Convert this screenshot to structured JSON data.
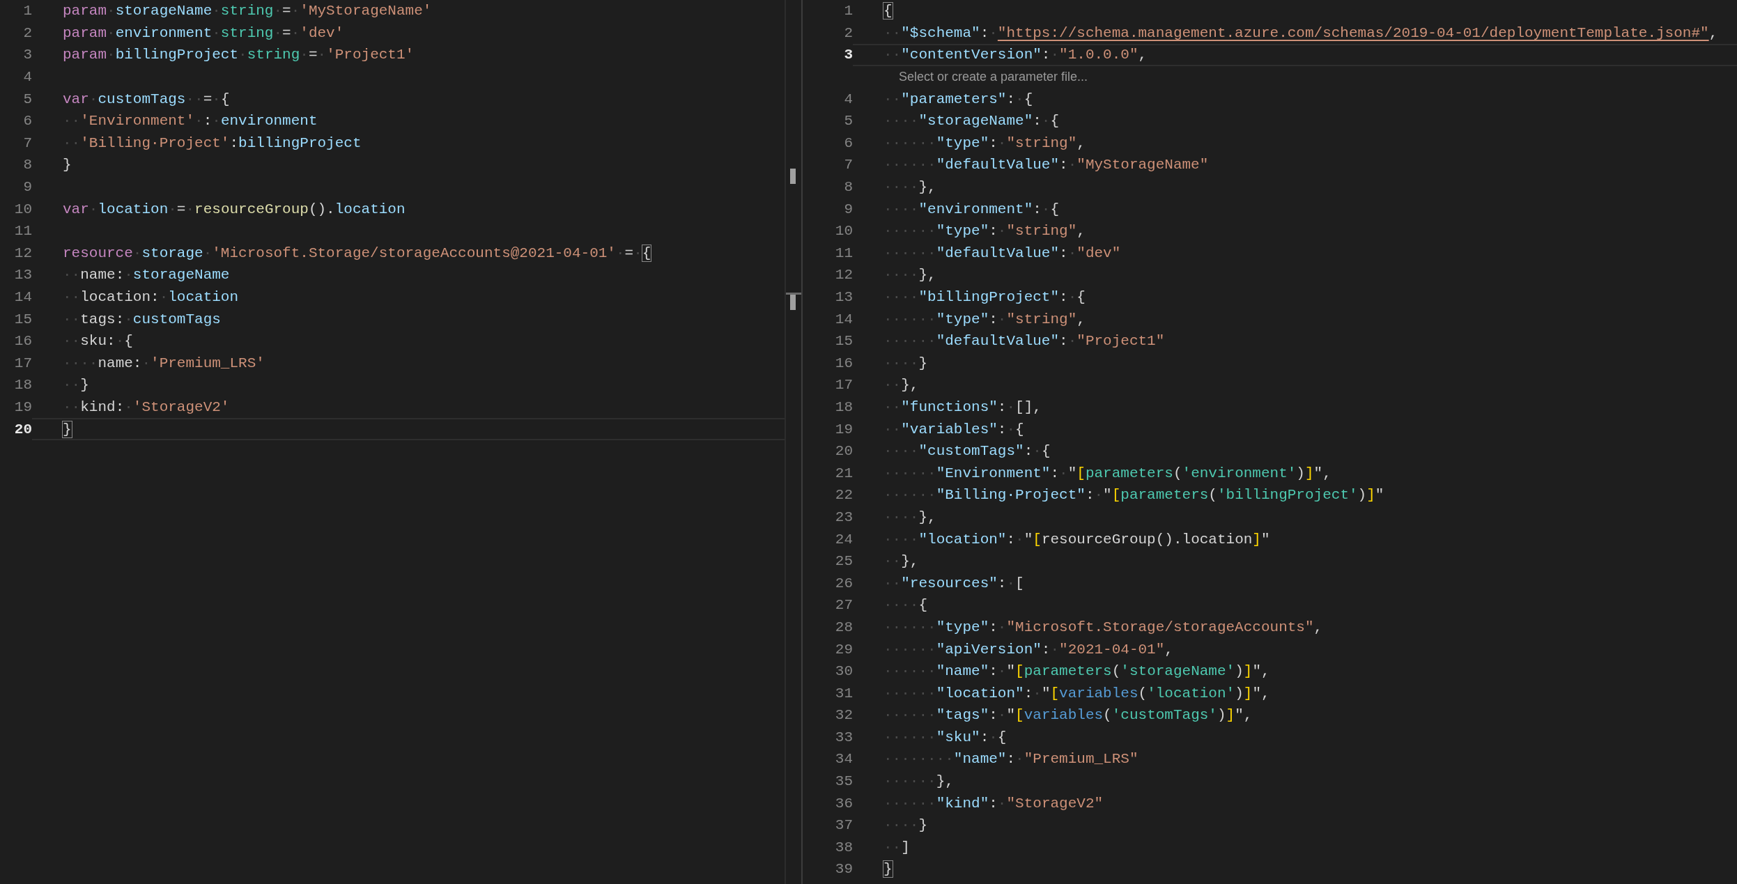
{
  "left_editor": {
    "lines": [
      {
        "number": "1",
        "current": false,
        "tokens": [
          {
            "kind": "kw",
            "text": "param"
          },
          {
            "kind": "ws",
            "text": "·"
          },
          {
            "kind": "id",
            "text": "storageName"
          },
          {
            "kind": "ws",
            "text": "·"
          },
          {
            "kind": "type",
            "text": "string"
          },
          {
            "kind": "ws",
            "text": "·"
          },
          {
            "kind": "p",
            "text": "="
          },
          {
            "kind": "ws",
            "text": "·"
          },
          {
            "kind": "str",
            "text": "'MyStorageName'"
          }
        ]
      },
      {
        "number": "2",
        "current": false,
        "tokens": [
          {
            "kind": "kw",
            "text": "param"
          },
          {
            "kind": "ws",
            "text": "·"
          },
          {
            "kind": "id",
            "text": "environment"
          },
          {
            "kind": "ws",
            "text": "·"
          },
          {
            "kind": "type",
            "text": "string"
          },
          {
            "kind": "ws",
            "text": "·"
          },
          {
            "kind": "p",
            "text": "="
          },
          {
            "kind": "ws",
            "text": "·"
          },
          {
            "kind": "str",
            "text": "'dev'"
          }
        ]
      },
      {
        "number": "3",
        "current": false,
        "tokens": [
          {
            "kind": "kw",
            "text": "param"
          },
          {
            "kind": "ws",
            "text": "·"
          },
          {
            "kind": "id",
            "text": "billingProject"
          },
          {
            "kind": "ws",
            "text": "·"
          },
          {
            "kind": "type",
            "text": "string"
          },
          {
            "kind": "ws",
            "text": "·"
          },
          {
            "kind": "p",
            "text": "="
          },
          {
            "kind": "ws",
            "text": "·"
          },
          {
            "kind": "str",
            "text": "'Project1'"
          }
        ]
      },
      {
        "number": "4",
        "current": false
      },
      {
        "number": "5",
        "current": false,
        "tokens": [
          {
            "kind": "kw",
            "text": "var"
          },
          {
            "kind": "ws",
            "text": "·"
          },
          {
            "kind": "id",
            "text": "customTags"
          },
          {
            "kind": "ws",
            "text": "··"
          },
          {
            "kind": "p",
            "text": "="
          },
          {
            "kind": "ws",
            "text": "·"
          },
          {
            "kind": "p",
            "text": "{"
          }
        ]
      },
      {
        "number": "6",
        "current": false,
        "tokens": [
          {
            "kind": "ws",
            "text": "··"
          },
          {
            "kind": "str",
            "text": "'Environment'"
          },
          {
            "kind": "ws",
            "text": "·"
          },
          {
            "kind": "p",
            "text": ":"
          },
          {
            "kind": "ws",
            "text": "·"
          },
          {
            "kind": "id",
            "text": "environment"
          }
        ]
      },
      {
        "number": "7",
        "current": false,
        "tokens": [
          {
            "kind": "ws",
            "text": "··"
          },
          {
            "kind": "str",
            "text": "'Billing·Project'"
          },
          {
            "kind": "p",
            "text": ":"
          },
          {
            "kind": "id",
            "text": "billingProject"
          }
        ]
      },
      {
        "number": "8",
        "current": false,
        "tokens": [
          {
            "kind": "p",
            "text": "}"
          }
        ]
      },
      {
        "number": "9",
        "current": false
      },
      {
        "number": "10",
        "current": false,
        "tokens": [
          {
            "kind": "kw",
            "text": "var"
          },
          {
            "kind": "ws",
            "text": "·"
          },
          {
            "kind": "id",
            "text": "location"
          },
          {
            "kind": "ws",
            "text": "·"
          },
          {
            "kind": "p",
            "text": "="
          },
          {
            "kind": "ws",
            "text": "·"
          },
          {
            "kind": "fn",
            "text": "resourceGroup"
          },
          {
            "kind": "p",
            "text": "()."
          },
          {
            "kind": "id",
            "text": "location"
          }
        ]
      },
      {
        "number": "11",
        "current": false
      },
      {
        "number": "12",
        "current": false,
        "tokens": [
          {
            "kind": "kw",
            "text": "resource"
          },
          {
            "kind": "ws",
            "text": "·"
          },
          {
            "kind": "id",
            "text": "storage"
          },
          {
            "kind": "ws",
            "text": "·"
          },
          {
            "kind": "str",
            "text": "'Microsoft.Storage/storageAccounts@2021-04-01'"
          },
          {
            "kind": "ws",
            "text": "·"
          },
          {
            "kind": "p",
            "text": "="
          },
          {
            "kind": "ws",
            "text": "·"
          },
          {
            "kind": "m",
            "text": "{"
          }
        ]
      },
      {
        "number": "13",
        "current": false,
        "tokens": [
          {
            "kind": "ws",
            "text": "··"
          },
          {
            "kind": "p",
            "text": "name:"
          },
          {
            "kind": "ws",
            "text": "·"
          },
          {
            "kind": "id",
            "text": "storageName"
          }
        ]
      },
      {
        "number": "14",
        "current": false,
        "tokens": [
          {
            "kind": "ws",
            "text": "··"
          },
          {
            "kind": "p",
            "text": "location:"
          },
          {
            "kind": "ws",
            "text": "·"
          },
          {
            "kind": "id",
            "text": "location"
          }
        ]
      },
      {
        "number": "15",
        "current": false,
        "tokens": [
          {
            "kind": "ws",
            "text": "··"
          },
          {
            "kind": "p",
            "text": "tags:"
          },
          {
            "kind": "ws",
            "text": "·"
          },
          {
            "kind": "id",
            "text": "customTags"
          }
        ]
      },
      {
        "number": "16",
        "current": false,
        "tokens": [
          {
            "kind": "ws",
            "text": "··"
          },
          {
            "kind": "p",
            "text": "sku:"
          },
          {
            "kind": "ws",
            "text": "·"
          },
          {
            "kind": "p",
            "text": "{"
          }
        ]
      },
      {
        "number": "17",
        "current": false,
        "tokens": [
          {
            "kind": "ws",
            "text": "····"
          },
          {
            "kind": "p",
            "text": "name:"
          },
          {
            "kind": "ws",
            "text": "·"
          },
          {
            "kind": "str",
            "text": "'Premium_LRS'"
          }
        ]
      },
      {
        "number": "18",
        "current": false,
        "tokens": [
          {
            "kind": "ws",
            "text": "··"
          },
          {
            "kind": "p",
            "text": "}"
          }
        ]
      },
      {
        "number": "19",
        "current": false,
        "tokens": [
          {
            "kind": "ws",
            "text": "··"
          },
          {
            "kind": "p",
            "text": "kind:"
          },
          {
            "kind": "ws",
            "text": "·"
          },
          {
            "kind": "str",
            "text": "'StorageV2'"
          }
        ]
      },
      {
        "number": "20",
        "current": true,
        "tokens": [
          {
            "kind": "m",
            "text": "}"
          }
        ]
      }
    ]
  },
  "right_editor": {
    "lines": [
      {
        "number": "1",
        "current": false,
        "tokens": [
          {
            "kind": "m",
            "text": "{"
          }
        ]
      },
      {
        "number": "2",
        "current": false,
        "tokens": [
          {
            "kind": "ws",
            "text": "··"
          },
          {
            "kind": "key",
            "text": "\"$schema\""
          },
          {
            "kind": "p",
            "text": ":"
          },
          {
            "kind": "ws",
            "text": "·"
          },
          {
            "kind": "link",
            "text": "\"https://schema.management.azure.com/schemas/2019-04-01/deploymentTemplate.json#\""
          },
          {
            "kind": "p",
            "text": ","
          }
        ]
      },
      {
        "number": "3",
        "current": true,
        "codelens": "Select or create a parameter file...",
        "tokens": [
          {
            "kind": "ws",
            "text": "··"
          },
          {
            "kind": "key",
            "text": "\"contentVersion\""
          },
          {
            "kind": "p",
            "text": ":"
          },
          {
            "kind": "ws",
            "text": "·"
          },
          {
            "kind": "str",
            "text": "\"1.0.0.0\""
          },
          {
            "kind": "p",
            "text": ","
          }
        ]
      },
      {
        "number": "4",
        "current": false,
        "tokens": [
          {
            "kind": "ws",
            "text": "··"
          },
          {
            "kind": "key",
            "text": "\"parameters\""
          },
          {
            "kind": "p",
            "text": ":"
          },
          {
            "kind": "ws",
            "text": "·"
          },
          {
            "kind": "p",
            "text": "{"
          }
        ]
      },
      {
        "number": "5",
        "current": false,
        "tokens": [
          {
            "kind": "ws",
            "text": "····"
          },
          {
            "kind": "key",
            "text": "\"storageName\""
          },
          {
            "kind": "p",
            "text": ":"
          },
          {
            "kind": "ws",
            "text": "·"
          },
          {
            "kind": "p",
            "text": "{"
          }
        ]
      },
      {
        "number": "6",
        "current": false,
        "tokens": [
          {
            "kind": "ws",
            "text": "······"
          },
          {
            "kind": "key",
            "text": "\"type\""
          },
          {
            "kind": "p",
            "text": ":"
          },
          {
            "kind": "ws",
            "text": "·"
          },
          {
            "kind": "str",
            "text": "\"string\""
          },
          {
            "kind": "p",
            "text": ","
          }
        ]
      },
      {
        "number": "7",
        "current": false,
        "tokens": [
          {
            "kind": "ws",
            "text": "······"
          },
          {
            "kind": "key",
            "text": "\"defaultValue\""
          },
          {
            "kind": "p",
            "text": ":"
          },
          {
            "kind": "ws",
            "text": "·"
          },
          {
            "kind": "str",
            "text": "\"MyStorageName\""
          }
        ]
      },
      {
        "number": "8",
        "current": false,
        "tokens": [
          {
            "kind": "ws",
            "text": "····"
          },
          {
            "kind": "p",
            "text": "},"
          }
        ]
      },
      {
        "number": "9",
        "current": false,
        "tokens": [
          {
            "kind": "ws",
            "text": "····"
          },
          {
            "kind": "key",
            "text": "\"environment\""
          },
          {
            "kind": "p",
            "text": ":"
          },
          {
            "kind": "ws",
            "text": "·"
          },
          {
            "kind": "p",
            "text": "{"
          }
        ]
      },
      {
        "number": "10",
        "current": false,
        "tokens": [
          {
            "kind": "ws",
            "text": "······"
          },
          {
            "kind": "key",
            "text": "\"type\""
          },
          {
            "kind": "p",
            "text": ":"
          },
          {
            "kind": "ws",
            "text": "·"
          },
          {
            "kind": "str",
            "text": "\"string\""
          },
          {
            "kind": "p",
            "text": ","
          }
        ]
      },
      {
        "number": "11",
        "current": false,
        "tokens": [
          {
            "kind": "ws",
            "text": "······"
          },
          {
            "kind": "key",
            "text": "\"defaultValue\""
          },
          {
            "kind": "p",
            "text": ":"
          },
          {
            "kind": "ws",
            "text": "·"
          },
          {
            "kind": "str",
            "text": "\"dev\""
          }
        ]
      },
      {
        "number": "12",
        "current": false,
        "tokens": [
          {
            "kind": "ws",
            "text": "····"
          },
          {
            "kind": "p",
            "text": "},"
          }
        ]
      },
      {
        "number": "13",
        "current": false,
        "tokens": [
          {
            "kind": "ws",
            "text": "····"
          },
          {
            "kind": "key",
            "text": "\"billingProject\""
          },
          {
            "kind": "p",
            "text": ":"
          },
          {
            "kind": "ws",
            "text": "·"
          },
          {
            "kind": "p",
            "text": "{"
          }
        ]
      },
      {
        "number": "14",
        "current": false,
        "tokens": [
          {
            "kind": "ws",
            "text": "······"
          },
          {
            "kind": "key",
            "text": "\"type\""
          },
          {
            "kind": "p",
            "text": ":"
          },
          {
            "kind": "ws",
            "text": "·"
          },
          {
            "kind": "str",
            "text": "\"string\""
          },
          {
            "kind": "p",
            "text": ","
          }
        ]
      },
      {
        "number": "15",
        "current": false,
        "tokens": [
          {
            "kind": "ws",
            "text": "······"
          },
          {
            "kind": "key",
            "text": "\"defaultValue\""
          },
          {
            "kind": "p",
            "text": ":"
          },
          {
            "kind": "ws",
            "text": "·"
          },
          {
            "kind": "str",
            "text": "\"Project1\""
          }
        ]
      },
      {
        "number": "16",
        "current": false,
        "tokens": [
          {
            "kind": "ws",
            "text": "····"
          },
          {
            "kind": "p",
            "text": "}"
          }
        ]
      },
      {
        "number": "17",
        "current": false,
        "tokens": [
          {
            "kind": "ws",
            "text": "··"
          },
          {
            "kind": "p",
            "text": "},"
          }
        ]
      },
      {
        "number": "18",
        "current": false,
        "tokens": [
          {
            "kind": "ws",
            "text": "··"
          },
          {
            "kind": "key",
            "text": "\"functions\""
          },
          {
            "kind": "p",
            "text": ":"
          },
          {
            "kind": "ws",
            "text": "·"
          },
          {
            "kind": "p",
            "text": "[],"
          }
        ]
      },
      {
        "number": "19",
        "current": false,
        "tokens": [
          {
            "kind": "ws",
            "text": "··"
          },
          {
            "kind": "key",
            "text": "\"variables\""
          },
          {
            "kind": "p",
            "text": ":"
          },
          {
            "kind": "ws",
            "text": "·"
          },
          {
            "kind": "p",
            "text": "{"
          }
        ]
      },
      {
        "number": "20",
        "current": false,
        "tokens": [
          {
            "kind": "ws",
            "text": "····"
          },
          {
            "kind": "key",
            "text": "\"customTags\""
          },
          {
            "kind": "p",
            "text": ":"
          },
          {
            "kind": "ws",
            "text": "·"
          },
          {
            "kind": "p",
            "text": "{"
          }
        ]
      },
      {
        "number": "21",
        "current": false,
        "tokens": [
          {
            "kind": "ws",
            "text": "······"
          },
          {
            "kind": "key",
            "text": "\"Environment\""
          },
          {
            "kind": "p",
            "text": ":"
          },
          {
            "kind": "ws",
            "text": "·"
          },
          {
            "kind": "p",
            "text": "\""
          },
          {
            "kind": "eb",
            "text": "["
          },
          {
            "kind": "ef",
            "text": "parameters"
          },
          {
            "kind": "p",
            "text": "("
          },
          {
            "kind": "es",
            "text": "'environment'"
          },
          {
            "kind": "p",
            "text": ")"
          },
          {
            "kind": "eb",
            "text": "]"
          },
          {
            "kind": "p",
            "text": "\","
          }
        ]
      },
      {
        "number": "22",
        "current": false,
        "tokens": [
          {
            "kind": "ws",
            "text": "······"
          },
          {
            "kind": "key",
            "text": "\"Billing·Project\""
          },
          {
            "kind": "p",
            "text": ":"
          },
          {
            "kind": "ws",
            "text": "·"
          },
          {
            "kind": "p",
            "text": "\""
          },
          {
            "kind": "eb",
            "text": "["
          },
          {
            "kind": "ef",
            "text": "parameters"
          },
          {
            "kind": "p",
            "text": "("
          },
          {
            "kind": "es",
            "text": "'billingProject'"
          },
          {
            "kind": "p",
            "text": ")"
          },
          {
            "kind": "eb",
            "text": "]"
          },
          {
            "kind": "p",
            "text": "\""
          }
        ]
      },
      {
        "number": "23",
        "current": false,
        "tokens": [
          {
            "kind": "ws",
            "text": "····"
          },
          {
            "kind": "p",
            "text": "},"
          }
        ]
      },
      {
        "number": "24",
        "current": false,
        "tokens": [
          {
            "kind": "ws",
            "text": "····"
          },
          {
            "kind": "key",
            "text": "\"location\""
          },
          {
            "kind": "p",
            "text": ":"
          },
          {
            "kind": "ws",
            "text": "·"
          },
          {
            "kind": "p",
            "text": "\""
          },
          {
            "kind": "eb",
            "text": "["
          },
          {
            "kind": "p",
            "text": "resourceGroup().location"
          },
          {
            "kind": "eb",
            "text": "]"
          },
          {
            "kind": "p",
            "text": "\""
          }
        ]
      },
      {
        "number": "25",
        "current": false,
        "tokens": [
          {
            "kind": "ws",
            "text": "··"
          },
          {
            "kind": "p",
            "text": "},"
          }
        ]
      },
      {
        "number": "26",
        "current": false,
        "tokens": [
          {
            "kind": "ws",
            "text": "··"
          },
          {
            "kind": "key",
            "text": "\"resources\""
          },
          {
            "kind": "p",
            "text": ":"
          },
          {
            "kind": "ws",
            "text": "·"
          },
          {
            "kind": "p",
            "text": "["
          }
        ]
      },
      {
        "number": "27",
        "current": false,
        "tokens": [
          {
            "kind": "ws",
            "text": "····"
          },
          {
            "kind": "p",
            "text": "{"
          }
        ]
      },
      {
        "number": "28",
        "current": false,
        "tokens": [
          {
            "kind": "ws",
            "text": "······"
          },
          {
            "kind": "key",
            "text": "\"type\""
          },
          {
            "kind": "p",
            "text": ":"
          },
          {
            "kind": "ws",
            "text": "·"
          },
          {
            "kind": "str",
            "text": "\"Microsoft.Storage/storageAccounts\""
          },
          {
            "kind": "p",
            "text": ","
          }
        ]
      },
      {
        "number": "29",
        "current": false,
        "tokens": [
          {
            "kind": "ws",
            "text": "······"
          },
          {
            "kind": "key",
            "text": "\"apiVersion\""
          },
          {
            "kind": "p",
            "text": ":"
          },
          {
            "kind": "ws",
            "text": "·"
          },
          {
            "kind": "str",
            "text": "\"2021-04-01\""
          },
          {
            "kind": "p",
            "text": ","
          }
        ]
      },
      {
        "number": "30",
        "current": false,
        "tokens": [
          {
            "kind": "ws",
            "text": "······"
          },
          {
            "kind": "key",
            "text": "\"name\""
          },
          {
            "kind": "p",
            "text": ":"
          },
          {
            "kind": "ws",
            "text": "·"
          },
          {
            "kind": "p",
            "text": "\""
          },
          {
            "kind": "eb",
            "text": "["
          },
          {
            "kind": "ef",
            "text": "parameters"
          },
          {
            "kind": "p",
            "text": "("
          },
          {
            "kind": "es",
            "text": "'storageName'"
          },
          {
            "kind": "p",
            "text": ")"
          },
          {
            "kind": "eb",
            "text": "]"
          },
          {
            "kind": "p",
            "text": "\","
          }
        ]
      },
      {
        "number": "31",
        "current": false,
        "tokens": [
          {
            "kind": "ws",
            "text": "······"
          },
          {
            "kind": "key",
            "text": "\"location\""
          },
          {
            "kind": "p",
            "text": ":"
          },
          {
            "kind": "ws",
            "text": "·"
          },
          {
            "kind": "p",
            "text": "\""
          },
          {
            "kind": "eb",
            "text": "["
          },
          {
            "kind": "ev",
            "text": "variables"
          },
          {
            "kind": "p",
            "text": "("
          },
          {
            "kind": "es",
            "text": "'location'"
          },
          {
            "kind": "p",
            "text": ")"
          },
          {
            "kind": "eb",
            "text": "]"
          },
          {
            "kind": "p",
            "text": "\","
          }
        ]
      },
      {
        "number": "32",
        "current": false,
        "tokens": [
          {
            "kind": "ws",
            "text": "······"
          },
          {
            "kind": "key",
            "text": "\"tags\""
          },
          {
            "kind": "p",
            "text": ":"
          },
          {
            "kind": "ws",
            "text": "·"
          },
          {
            "kind": "p",
            "text": "\""
          },
          {
            "kind": "eb",
            "text": "["
          },
          {
            "kind": "ev",
            "text": "variables"
          },
          {
            "kind": "p",
            "text": "("
          },
          {
            "kind": "es",
            "text": "'customTags'"
          },
          {
            "kind": "p",
            "text": ")"
          },
          {
            "kind": "eb",
            "text": "]"
          },
          {
            "kind": "p",
            "text": "\","
          }
        ]
      },
      {
        "number": "33",
        "current": false,
        "tokens": [
          {
            "kind": "ws",
            "text": "······"
          },
          {
            "kind": "key",
            "text": "\"sku\""
          },
          {
            "kind": "p",
            "text": ":"
          },
          {
            "kind": "ws",
            "text": "·"
          },
          {
            "kind": "p",
            "text": "{"
          }
        ]
      },
      {
        "number": "34",
        "current": false,
        "tokens": [
          {
            "kind": "ws",
            "text": "········"
          },
          {
            "kind": "key",
            "text": "\"name\""
          },
          {
            "kind": "p",
            "text": ":"
          },
          {
            "kind": "ws",
            "text": "·"
          },
          {
            "kind": "str",
            "text": "\"Premium_LRS\""
          }
        ]
      },
      {
        "number": "35",
        "current": false,
        "tokens": [
          {
            "kind": "ws",
            "text": "······"
          },
          {
            "kind": "p",
            "text": "},"
          }
        ]
      },
      {
        "number": "36",
        "current": false,
        "tokens": [
          {
            "kind": "ws",
            "text": "······"
          },
          {
            "kind": "key",
            "text": "\"kind\""
          },
          {
            "kind": "p",
            "text": ":"
          },
          {
            "kind": "ws",
            "text": "·"
          },
          {
            "kind": "str",
            "text": "\"StorageV2\""
          }
        ]
      },
      {
        "number": "37",
        "current": false,
        "tokens": [
          {
            "kind": "ws",
            "text": "····"
          },
          {
            "kind": "p",
            "text": "}"
          }
        ]
      },
      {
        "number": "38",
        "current": false,
        "tokens": [
          {
            "kind": "ws",
            "text": "··"
          },
          {
            "kind": "p",
            "text": "]"
          }
        ]
      },
      {
        "number": "39",
        "current": false,
        "tokens": [
          {
            "kind": "m",
            "text": "}"
          }
        ]
      }
    ]
  }
}
